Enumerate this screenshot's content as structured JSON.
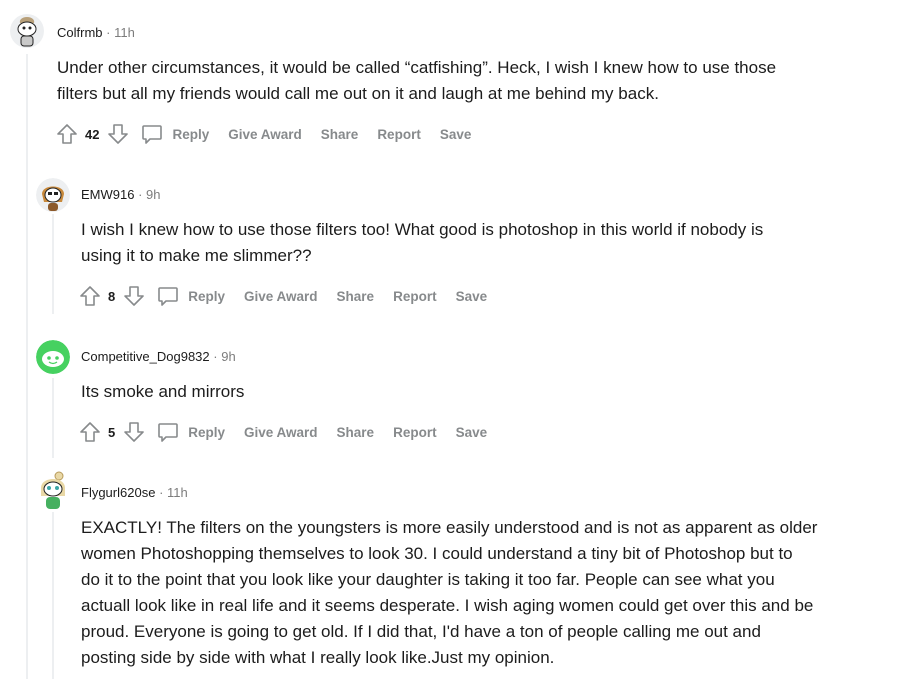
{
  "actions": {
    "reply": "Reply",
    "give_award": "Give Award",
    "share": "Share",
    "report": "Report",
    "save": "Save"
  },
  "comments": [
    {
      "username": "Colfrmb",
      "time": "11h",
      "body_lines": [
        "Under other circumstances, it would be called “catfishing”. Heck, I wish I knew how to use those",
        "filters but all my friends would call me out on it and laugh at me behind my back."
      ],
      "score": "42"
    },
    {
      "username": "EMW916",
      "time": "9h",
      "body_lines": [
        "I wish I knew how to use those filters too! What good is photoshop in this world if nobody is",
        "using it to make me slimmer??"
      ],
      "score": "8"
    },
    {
      "username": "Competitive_Dog9832",
      "time": "9h",
      "body_lines": [
        "Its smoke and mirrors"
      ],
      "score": "5"
    },
    {
      "username": "Flygurl620se",
      "time": "11h",
      "body_lines": [
        "EXACTLY! The filters on the youngsters is more easily understood and is not as apparent as older",
        "women Photoshopping themselves to look 30. I could understand a tiny bit of Photoshop but to",
        "do it to the point that you look like your daughter is taking it too far. People can see what you",
        "actuall look like in real life and it seems desperate. I wish aging women could get over this and be",
        "proud. Everyone is going to get old. If I did that, I'd have a ton of people calling me out and",
        "posting side by side with what I really look like.Just my opinion."
      ]
    }
  ]
}
